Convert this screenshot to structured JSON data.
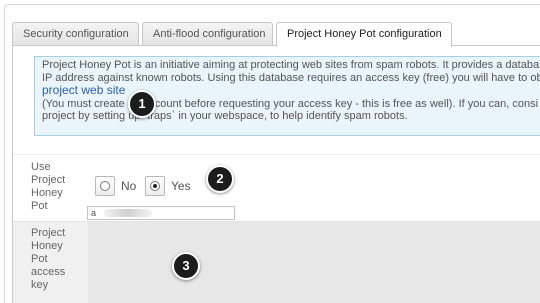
{
  "tabs": [
    {
      "label": "Security configuration",
      "active": false
    },
    {
      "label": "Anti-flood configuration",
      "active": false
    },
    {
      "label": "Project Honey Pot configuration",
      "active": true
    }
  ],
  "info": {
    "line1": "Project Honey Pot is an initiative aiming at protecting web sites from spam robots. It provides a database",
    "line2": "IP address against known robots. Using this database requires an access key (free) you will have to obt",
    "link": "project web site",
    "line3": "(You must create an account before requesting your access key - this is free as well). If you can, consi",
    "line4": "project by setting up `traps` in your webspace, to help identify spam robots."
  },
  "use_field": {
    "label_lines": [
      "Use",
      "Project",
      "Honey",
      "Pot"
    ],
    "option_no": "No",
    "option_yes": "Yes",
    "selected": "Yes"
  },
  "key_field": {
    "label_lines": [
      "Project",
      "Honey",
      "Pot",
      "access",
      "key"
    ],
    "value": "a"
  },
  "markers": [
    "1",
    "2",
    "3"
  ],
  "colors": {
    "info_bg": "#eaf4fb",
    "info_border": "#a9cfe8",
    "link": "#2b5fa8",
    "marker": "#1c1c1c"
  }
}
